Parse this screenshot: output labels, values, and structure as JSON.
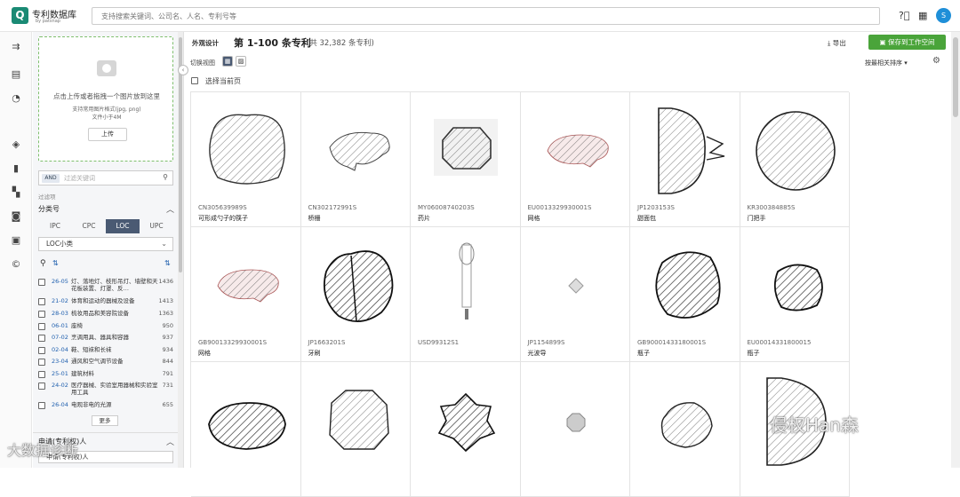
{
  "app": {
    "title": "专利数据库",
    "subtitle": "by patsnap",
    "logo_glyph": "Q",
    "search_placeholder": "支持搜索关键词、公司名、人名、专利号等",
    "avatar_letter": "S"
  },
  "sidebar": {
    "upload": {
      "hint": "点击上传或者拖拽一个图片放到这里",
      "formats": "支持常用图片格式(jpg, png)",
      "size": "文件小于4M",
      "button": "上传"
    },
    "keyword": {
      "op": "AND",
      "placeholder": "过滤关键词"
    },
    "filter_label": "过滤项",
    "classification_title": "分类号",
    "tabs": [
      "IPC",
      "CPC",
      "LOC",
      "UPC"
    ],
    "active_tab": "LOC",
    "loc_select": "LOC小类",
    "loc_items": [
      {
        "code": "26-05",
        "name": "灯、落地灯、枝形吊灯、墙壁和天花板装置、灯罩、反…",
        "count": "1436"
      },
      {
        "code": "21-02",
        "name": "体育和运动的器械及设备",
        "count": "1413"
      },
      {
        "code": "28-03",
        "name": "梳妆用品和美容院设备",
        "count": "1363"
      },
      {
        "code": "06-01",
        "name": "座椅",
        "count": "950"
      },
      {
        "code": "07-02",
        "name": "烹调用具、器具和容器",
        "count": "937"
      },
      {
        "code": "02-04",
        "name": "鞋、短袜和长袜",
        "count": "934"
      },
      {
        "code": "23-04",
        "name": "通风和空气调节设备",
        "count": "844"
      },
      {
        "code": "25-01",
        "name": "建筑材料",
        "count": "791"
      },
      {
        "code": "24-02",
        "name": "医疗器械、实验室用器械和实验室用工具",
        "count": "731"
      },
      {
        "code": "26-04",
        "name": "电观非电的光源",
        "count": "655"
      }
    ],
    "more": "更多",
    "applicant_title": "申请(专利权)人",
    "applicant_select": "申请(专利权)人"
  },
  "main": {
    "tag": "外观设计",
    "title": "第 1-100 条专利",
    "count": "(共 32,382 条专利)",
    "export": "导出",
    "save": "保存到工作空间",
    "view_label": "切换视图",
    "sort": "按最相关排序",
    "select_page": "选择当前页",
    "cells": [
      {
        "pn": "CN305639989S",
        "title": "可形成勺子的筷子",
        "shape": "rounded-square"
      },
      {
        "pn": "CN302172991S",
        "title": "桥栅",
        "shape": "flat-ellipse"
      },
      {
        "pn": "MY06008740203S",
        "title": "药片",
        "shape": "octagon"
      },
      {
        "pn": "EU0013329930001S",
        "title": "网格",
        "shape": "flat-ellipse-light"
      },
      {
        "pn": "JP1203153S",
        "title": "甜面包",
        "shape": "half-circle"
      },
      {
        "pn": "KR300384885S",
        "title": "门把手",
        "shape": "circle"
      },
      {
        "pn": "GB90013329930001S",
        "title": "网格",
        "shape": "flat-ellipse-light"
      },
      {
        "pn": "JP1663201S",
        "title": "牙刷",
        "shape": "lobes"
      },
      {
        "pn": "USD99312S1",
        "title": "",
        "shape": "stick"
      },
      {
        "pn": "JP1154899S",
        "title": "光波导",
        "shape": "small-diamond"
      },
      {
        "pn": "GB90001433180001S",
        "title": "瓶子",
        "shape": "blob"
      },
      {
        "pn": "EU00014331800015",
        "title": "瓶子",
        "shape": "blob-small"
      },
      {
        "pn": "",
        "title": "",
        "shape": "wide-ellipse"
      },
      {
        "pn": "",
        "title": "",
        "shape": "octagon-round"
      },
      {
        "pn": "",
        "title": "",
        "shape": "star-circle"
      },
      {
        "pn": "",
        "title": "",
        "shape": "small-octagon"
      },
      {
        "pn": "",
        "title": "",
        "shape": "blob-medium"
      },
      {
        "pn": "",
        "title": "",
        "shape": "half-circle-big"
      }
    ]
  },
  "watermarks": {
    "right": "侵权Han森",
    "left": "大数据诊断"
  },
  "colors": {
    "accent": "#4a5a73",
    "save": "#4aa43a",
    "link": "#1f5fae",
    "logo": "#1a8a74"
  }
}
